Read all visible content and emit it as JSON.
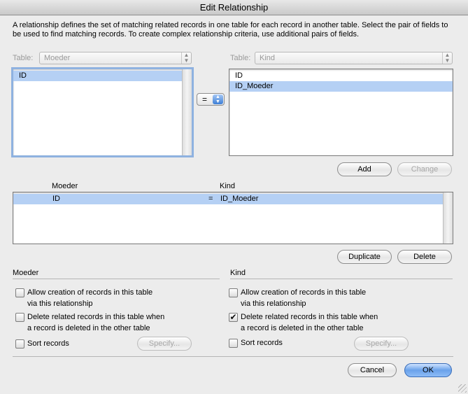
{
  "window": {
    "title": "Edit Relationship"
  },
  "description": "A relationship defines the set of matching related records in one table for each record in another table. Select the pair of fields to be used to find matching records. To create complex relationship criteria, use additional pairs of fields.",
  "left_table": {
    "label": "Table:",
    "value": "Moeder",
    "fields": [
      "ID"
    ],
    "selected": "ID"
  },
  "right_table": {
    "label": "Table:",
    "value": "Kind",
    "fields": [
      "ID",
      "ID_Moeder"
    ],
    "selected": "ID_Moeder"
  },
  "operator": {
    "value": "="
  },
  "buttons": {
    "add": "Add",
    "change": "Change",
    "duplicate": "Duplicate",
    "delete": "Delete",
    "cancel": "Cancel",
    "ok": "OK",
    "specify_left": "Specify...",
    "specify_right": "Specify..."
  },
  "criteria": {
    "col_left": "Moeder",
    "col_right": "Kind",
    "rows": [
      {
        "left": "ID",
        "op": "=",
        "right": "ID_Moeder"
      }
    ]
  },
  "options_left": {
    "header": "Moeder",
    "allow_line1": "Allow creation of records in this table",
    "allow_line2": "via this relationship",
    "delete_line1": "Delete related records in this table when",
    "delete_line2": "a record is deleted in the other table",
    "sort": "Sort records",
    "allow_checked": false,
    "delete_checked": false,
    "sort_checked": false
  },
  "options_right": {
    "header": "Kind",
    "allow_line1": "Allow creation of records in this table",
    "allow_line2": "via this relationship",
    "delete_line1": "Delete related records in this table when",
    "delete_line2": "a record is deleted in the other table",
    "sort": "Sort records",
    "allow_checked": false,
    "delete_checked": true,
    "sort_checked": false
  }
}
